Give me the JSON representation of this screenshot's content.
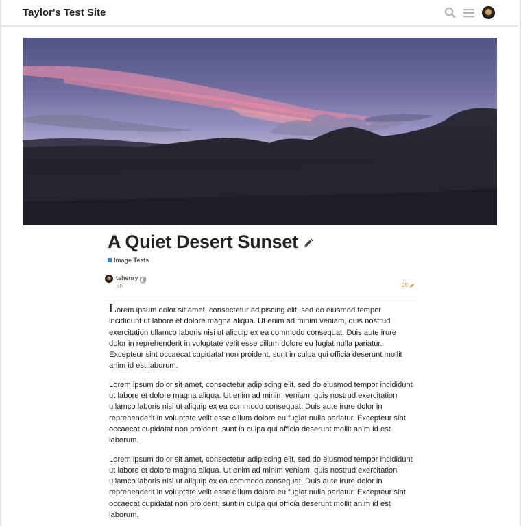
{
  "header": {
    "site_title": "Taylor's Test Site",
    "icons": [
      "search-icon",
      "hamburger-menu-icon",
      "user-avatar"
    ]
  },
  "topic": {
    "title": "A Quiet Desert Sunset",
    "category": {
      "name": "Image Tests",
      "color": "#2a8bd0"
    }
  },
  "post": {
    "author": "tshenry",
    "age": "5h",
    "edit_count": "25",
    "paragraph_1_dropcap": "L",
    "paragraph_1_rest": "orem ipsum dolor sit amet, consectetur adipiscing elit, sed do eiusmod tempor incididunt ut labore et dolore magna aliqua. Ut enim ad minim veniam, quis nostrud exercitation ullamco laboris nisi ut aliquip ex ea commodo consequat. Duis aute irure dolor in reprehenderit in voluptate velit esse cillum dolore eu fugiat nulla pariatur. Excepteur sint occaecat cupidatat non proident, sunt in culpa qui officia deserunt mollit anim id est laborum.",
    "paragraph_2": "Lorem ipsum dolor sit amet, consectetur adipiscing elit, sed do eiusmod tempor incididunt ut labore et dolore magna aliqua. Ut enim ad minim veniam, quis nostrud exercitation ullamco laboris nisi ut aliquip ex ea commodo consequat. Duis aute irure dolor in reprehenderit in voluptate velit esse cillum dolore eu fugiat nulla pariatur. Excepteur sint occaecat cupidatat non proident, sunt in culpa qui officia deserunt mollit anim id est laborum.",
    "paragraph_3": "Lorem ipsum dolor sit amet, consectetur adipiscing elit, sed do eiusmod tempor incididunt ut labore et dolore magna aliqua. Ut enim ad minim veniam, quis nostrud exercitation ullamco laboris nisi ut aliquip ex ea commodo consequat. Duis aute irure dolor in reprehenderit in voluptate velit esse cillum dolore eu fugiat nulla pariatur. Excepteur sint occaecat cupidatat non proident, sunt in culpa qui officia deserunt mollit anim id est laborum."
  },
  "colors": {
    "accent_orange": "#e9852c",
    "text_dark": "#222222",
    "text_muted": "#999999"
  }
}
